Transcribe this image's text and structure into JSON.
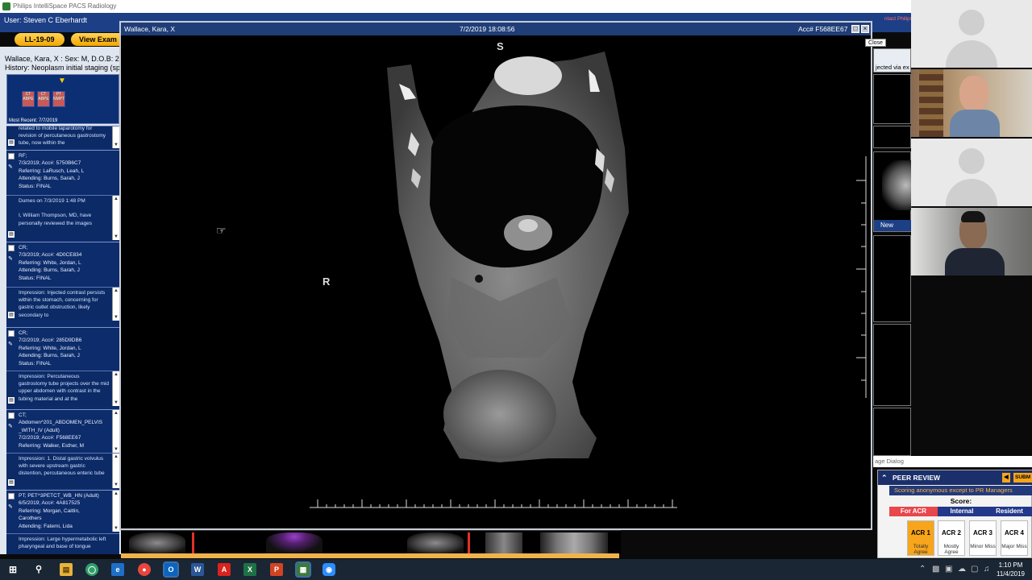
{
  "app": {
    "title": "Philips IntelliSpace PACS Radiology",
    "user": "User: Steven C Eberhardt",
    "worklist_button": "LL-19-09",
    "view_exam_button": "View Exam",
    "patient": "Wallace, Kara, X : Sex: M, D.O.B: 2",
    "history": "History: Neoplasm initial staging (sp",
    "most_recent": "Most Recent: 7/7/2019",
    "close_label": "Close"
  },
  "thumbs": [
    {
      "label": "CT ABPE"
    },
    {
      "label": "CT ABPE"
    },
    {
      "label": "PT NMPT"
    }
  ],
  "history_entries": [
    {
      "meta": "",
      "impression": "related to mobile laparotomy for revision of percutaneous gastrostomy tube, now within the"
    },
    {
      "meta": "RF;\n7/3/2019; Acc#: 5750B6C7\nReferring: LaRusch, Leah, L\nAttending: Burns, Sarah, J\nStatus: FINAL",
      "impression": "Dumes on 7/3/2019 1:48 PM\n\nI, William Thompson, MD, have personally reviewed the images"
    },
    {
      "meta": "CR;\n7/3/2019; Acc#: 4D0CE834\nReferring: White, Jordan, L\nAttending: Burns, Sarah, J\nStatus: FINAL",
      "impression": "Impression: Injected contrast persists within the stomach, concerning for gastric outlet obstruction, likely secondary to"
    },
    {
      "meta": "CR;\n7/2/2019; Acc#: 285D9DB6\nReferring: White, Jordan, L\nAttending: Burns, Sarah, J\nStatus: FINAL",
      "impression": "Impression: Percutaneous gastrostomy tube projects over the mid upper abdomen with contrast in the tubing material and at the"
    },
    {
      "meta": "CT;\nAbdomen^201_ABDOMEN_PELVIS\n_WITH_IV (Adult)\n7/2/2019; Acc#: F568EE67\nReferring: Walker, Esther, M",
      "impression": "Impression: 1.  Distal gastric volvulus with severe upstream gastric distention, percutaneous enteric tube"
    },
    {
      "meta": "PT; PET^3PETCT_WB_HN (Adult)\n6/5/2019; Acc#: 4A817525\nReferring: Morgan, Caitlin,\nCarothers\nAttending: Fatemi, Lida",
      "impression": "Impression: Large hypermetabolic left pharyngeal and base of tongue"
    }
  ],
  "viewer": {
    "patient": "Wallace, Kara, X",
    "datetime": "7/2/2019 18:08:56",
    "accession": "Acc# F568EE67",
    "orient_top": "S",
    "orient_left": "R"
  },
  "right_panel": {
    "text1": "ntact Philips Tech",
    "text2": "jected via ex",
    "new_label": "New",
    "dialog_label": "age Dialog"
  },
  "peer_review": {
    "title": "PEER REVIEW",
    "warning": "Scoring anonymous except to PR Managers",
    "score_label": "Score:",
    "submit_label": "SUBM",
    "tabs": [
      "For ACR",
      "Internal",
      "Resident"
    ],
    "acr": [
      {
        "label": "ACR 1",
        "desc": "Totally Agree",
        "selected": true
      },
      {
        "label": "ACR 2",
        "desc": "Mostly Agree",
        "selected": false
      },
      {
        "label": "ACR 3",
        "desc": "Minor Miss",
        "selected": false
      },
      {
        "label": "ACR 4",
        "desc": "Major Miss",
        "selected": false
      }
    ]
  },
  "taskbar": {
    "time": "1:10 PM",
    "date": "11/4/2019"
  },
  "colors": {
    "pacs_blue": "#1c3f86",
    "viewer_title": "#1f3e78",
    "orange": "#f2a700",
    "acr_selected": "#f7a51b"
  }
}
